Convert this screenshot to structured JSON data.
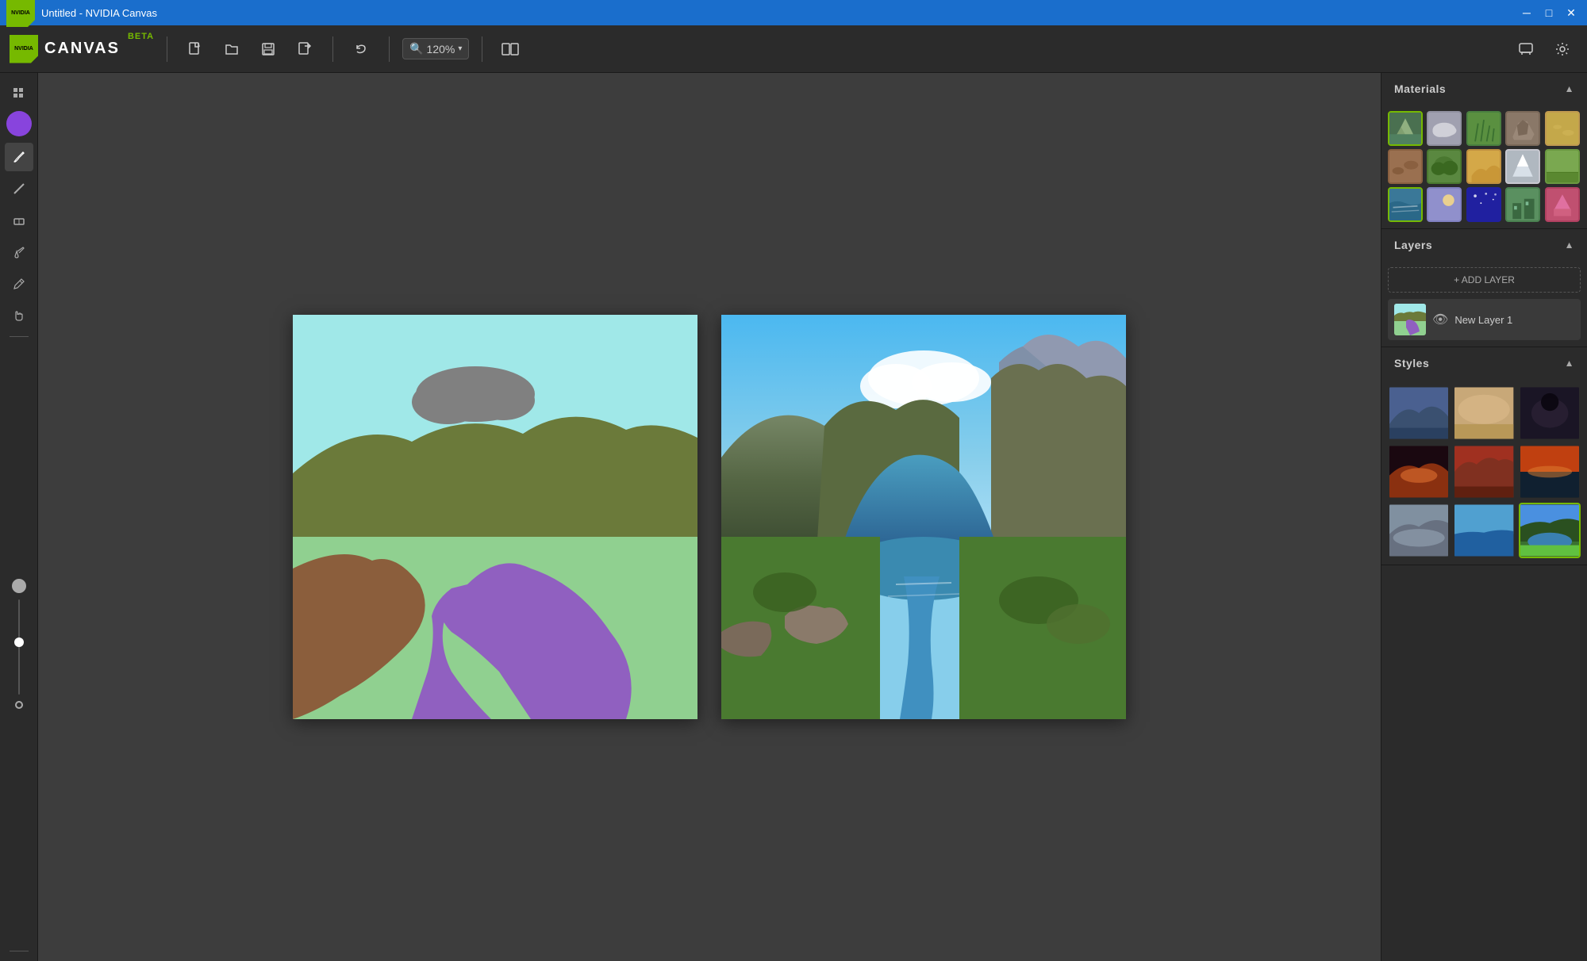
{
  "window": {
    "title": "Untitled - NVIDIA Canvas"
  },
  "titlebar": {
    "title": "Untitled - NVIDIA Canvas",
    "minimize": "─",
    "maximize": "□",
    "close": "✕"
  },
  "toolbar": {
    "app_name": "CANVAS",
    "app_badge": "BETA",
    "zoom_level": "120%",
    "new_label": "New",
    "open_label": "Open",
    "save_label": "Save",
    "export_label": "Export",
    "undo_label": "Undo",
    "compare_label": "Compare"
  },
  "tools": {
    "avatar_initials": "",
    "brush": "✏",
    "eraser": "◻",
    "bucket": "🪣",
    "flood": "◎",
    "eyedropper": "✒",
    "hand": "✋",
    "circle_outline": "○",
    "circle_filled": "●"
  },
  "right_panel": {
    "materials_label": "Materials",
    "layers_label": "Layers",
    "styles_label": "Styles",
    "add_layer_label": "+ ADD LAYER",
    "layer_name": "New Layer 1"
  },
  "materials": [
    {
      "id": "mountain-snow",
      "color": "#4a8060",
      "label": "Mountain Snow",
      "icon_bg": "#4a8060"
    },
    {
      "id": "cloud",
      "color": "#b0b0b0",
      "label": "Cloud",
      "icon_bg": "#b0b0b0"
    },
    {
      "id": "grass",
      "color": "#5cb85c",
      "label": "Grass",
      "icon_bg": "#5cb85c"
    },
    {
      "id": "rock",
      "color": "#8B8070",
      "label": "Rock",
      "icon_bg": "#8B8070"
    },
    {
      "id": "sand",
      "color": "#c2a55a",
      "label": "Sand",
      "icon_bg": "#c2a55a"
    },
    {
      "id": "dirt",
      "color": "#9b7a4a",
      "label": "Dirt",
      "icon_bg": "#9b7a4a"
    },
    {
      "id": "bush",
      "color": "#5a9040",
      "label": "Bush",
      "icon_bg": "#5a9040"
    },
    {
      "id": "desert",
      "color": "#d4a84b",
      "label": "Desert",
      "icon_bg": "#d4a84b"
    },
    {
      "id": "snow",
      "color": "#d0d0d0",
      "label": "Snow",
      "icon_bg": "#d0d0d0"
    },
    {
      "id": "field",
      "color": "#7ab84a",
      "label": "Field",
      "icon_bg": "#7ab84a"
    },
    {
      "id": "water",
      "color": "#3a8db5",
      "label": "Water",
      "icon_bg": "#4a99cc"
    },
    {
      "id": "sky",
      "color": "#9090cc",
      "label": "Sky",
      "icon_bg": "#9090cc"
    },
    {
      "id": "night",
      "color": "#3030a0",
      "label": "Night",
      "icon_bg": "#3030a0"
    },
    {
      "id": "building",
      "color": "#5a9a60",
      "label": "Building",
      "icon_bg": "#5a9a60"
    },
    {
      "id": "pink",
      "color": "#c05070",
      "label": "Pink",
      "icon_bg": "#c05070"
    }
  ],
  "styles": [
    {
      "id": "s1",
      "label": "Mountain valley",
      "colors": [
        "#3a6ea8",
        "#8B6040",
        "#4a6030"
      ]
    },
    {
      "id": "s2",
      "label": "Desert storm",
      "colors": [
        "#c8a070",
        "#a08050",
        "#d4b880"
      ]
    },
    {
      "id": "s3",
      "label": "Dark cave",
      "colors": [
        "#1a1a2a",
        "#2a1a1a",
        "#100010"
      ]
    },
    {
      "id": "s4",
      "label": "Sunset peaks",
      "colors": [
        "#c04000",
        "#e06020",
        "#1a0a00"
      ]
    },
    {
      "id": "s5",
      "label": "Red canyon",
      "colors": [
        "#883010",
        "#a04020",
        "#c06040"
      ]
    },
    {
      "id": "s6",
      "label": "Ocean sunset",
      "colors": [
        "#c04010",
        "#e08020",
        "#102030"
      ]
    },
    {
      "id": "s7",
      "label": "Mountain mist",
      "colors": [
        "#8090a0",
        "#90a0b0",
        "#606070"
      ]
    },
    {
      "id": "s8",
      "label": "Tropical shore",
      "colors": [
        "#3070c0",
        "#50a0e0",
        "#204050"
      ]
    },
    {
      "id": "s9",
      "label": "Alpine lake",
      "colors": [
        "#2a8040",
        "#1a6090",
        "#80c040"
      ]
    }
  ]
}
